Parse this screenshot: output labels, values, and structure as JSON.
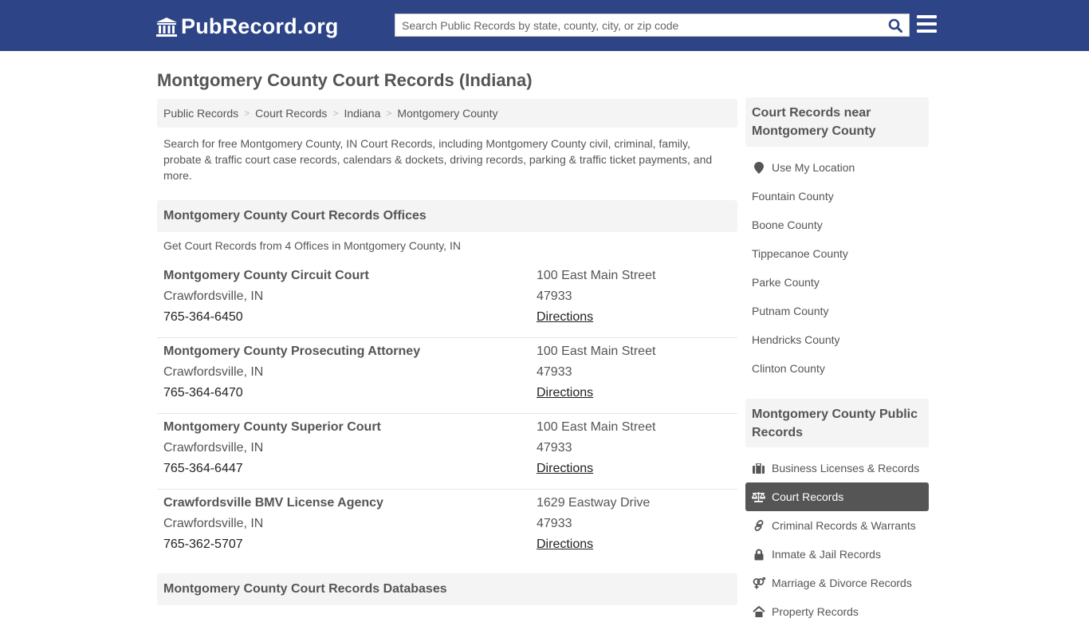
{
  "header": {
    "logo_text": "PubRecord.org",
    "search_placeholder": "Search Public Records by state, county, city, or zip code"
  },
  "page": {
    "title": "Montgomery County Court Records (Indiana)",
    "breadcrumb": [
      "Public Records",
      "Court Records",
      "Indiana",
      "Montgomery County"
    ],
    "breadcrumb_separator": ">",
    "intro": "Search for free Montgomery County, IN Court Records, including Montgomery County civil, criminal, family, probate & traffic court case records, calendars & dockets, driving records, parking & traffic ticket payments, and more."
  },
  "offices_section": {
    "heading": "Montgomery County Court Records Offices",
    "subtext": "Get Court Records from 4 Offices in Montgomery County, IN",
    "offices": [
      {
        "name": "Montgomery County Circuit Court",
        "city": "Crawfordsville, IN",
        "phone": "765-364-6450",
        "address": "100 East Main Street",
        "zip": "47933",
        "directions": "Directions"
      },
      {
        "name": "Montgomery County Prosecuting Attorney",
        "city": "Crawfordsville, IN",
        "phone": "765-364-6470",
        "address": "100 East Main Street",
        "zip": "47933",
        "directions": "Directions"
      },
      {
        "name": "Montgomery County Superior Court",
        "city": "Crawfordsville, IN",
        "phone": "765-364-6447",
        "address": "100 East Main Street",
        "zip": "47933",
        "directions": "Directions"
      },
      {
        "name": "Crawfordsville BMV License Agency",
        "city": "Crawfordsville, IN",
        "phone": "765-362-5707",
        "address": "1629 Eastway Drive",
        "zip": "47933",
        "directions": "Directions"
      }
    ]
  },
  "databases_section": {
    "heading": "Montgomery County Court Records Databases"
  },
  "sidebar": {
    "nearby": {
      "heading": "Court Records near Montgomery County",
      "use_location": "Use My Location",
      "counties": [
        "Fountain County",
        "Boone County",
        "Tippecanoe County",
        "Parke County",
        "Putnam County",
        "Hendricks County",
        "Clinton County"
      ]
    },
    "public_records": {
      "heading": "Montgomery County Public Records",
      "items": [
        {
          "label": "Business Licenses & Records",
          "icon": "briefcase-icon",
          "active": false
        },
        {
          "label": "Court Records",
          "icon": "scale-icon",
          "active": true
        },
        {
          "label": "Criminal Records & Warrants",
          "icon": "link-icon",
          "active": false
        },
        {
          "label": "Inmate & Jail Records",
          "icon": "lock-icon",
          "active": false
        },
        {
          "label": "Marriage & Divorce Records",
          "icon": "gender-icon",
          "active": false
        },
        {
          "label": "Property Records",
          "icon": "home-icon",
          "active": false
        }
      ]
    }
  },
  "colors": {
    "header_bg": "#2d4486",
    "search_icon": "#2d4486",
    "active_item_bg": "#555555",
    "panel_bg": "#f4f4f4"
  }
}
